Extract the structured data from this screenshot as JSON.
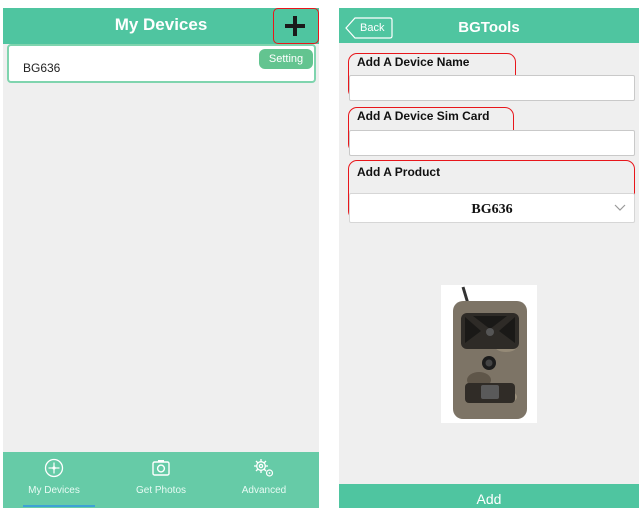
{
  "left_screen": {
    "header": {
      "title": "My Devices",
      "add_icon": "plus-icon"
    },
    "devices": [
      {
        "name": "BG636",
        "setting_label": "Setting"
      }
    ],
    "tabs": [
      {
        "label": "My Devices",
        "icon": "compass-icon",
        "selected": true
      },
      {
        "label": "Get Photos",
        "icon": "camera-icon",
        "selected": false
      },
      {
        "label": "Advanced",
        "icon": "gear-icon",
        "selected": false
      }
    ]
  },
  "right_screen": {
    "header": {
      "back_label": "Back",
      "title": "BGTools"
    },
    "form": {
      "device_name_label": "Add A Device Name",
      "device_name_value": "",
      "sim_card_label": "Add A Device Sim Card",
      "sim_card_value": "",
      "product_label": "Add A Product",
      "product_selected": "BG636"
    },
    "add_button_label": "Add"
  },
  "colors": {
    "accent_green": "#4fc5a0",
    "tab_bar_green": "#66cba7",
    "highlight_red": "#e8161b",
    "background_gray": "#efefef"
  }
}
